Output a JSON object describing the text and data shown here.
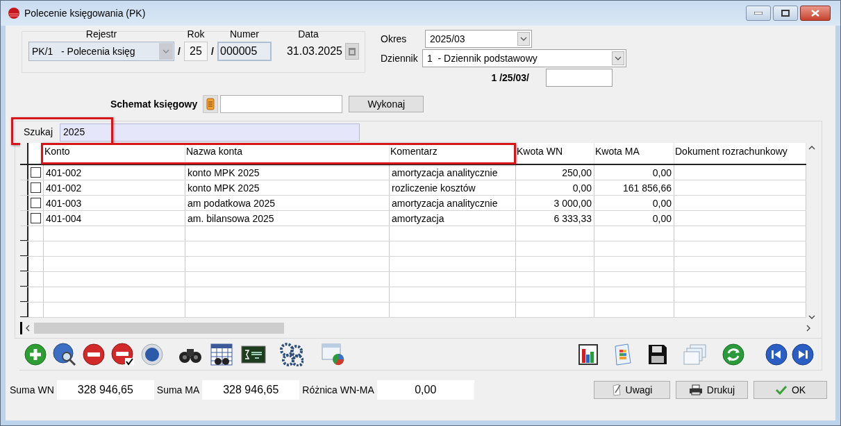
{
  "window": {
    "title": "Polecenie księgowania (PK)"
  },
  "document": {
    "rejestr": {
      "label": "Rejestr",
      "value": "PK/1   - Polecenia księg"
    },
    "rok": {
      "label": "Rok",
      "value": "25"
    },
    "numer": {
      "label": "Numer",
      "value": "000005"
    },
    "data": {
      "label": "Data",
      "value": "31.03.2025"
    },
    "separators": [
      "/",
      "/"
    ]
  },
  "okres": {
    "label": "Okres",
    "value": "2025/03"
  },
  "dziennik": {
    "label": "Dziennik",
    "value": "1  - Dziennik podstawowy",
    "number_prefix": "1 /25/03/"
  },
  "schemat": {
    "label": "Schemat księgowy",
    "button": "Wykonaj"
  },
  "search": {
    "label": "Szukaj",
    "value": "2025",
    "highlighted": true
  },
  "table": {
    "columns": [
      {
        "label": "Konto",
        "highlighted": true
      },
      {
        "label": "Nazwa konta",
        "highlighted": true
      },
      {
        "label": "Komentarz",
        "highlighted": true
      },
      {
        "label": "Kwota WN",
        "highlighted": false
      },
      {
        "label": "Kwota MA",
        "highlighted": false
      },
      {
        "label": "Dokument rozrachunkowy",
        "highlighted": false
      }
    ],
    "rows": [
      {
        "checked": false,
        "cells": [
          "401-002",
          "konto MPK 2025",
          "amortyzacja analitycznie",
          "250,00",
          "0,00"
        ]
      },
      {
        "checked": false,
        "cells": [
          "401-002",
          "konto MPK 2025",
          "rozliczenie kosztów",
          "0,00",
          "161 856,66"
        ]
      },
      {
        "checked": false,
        "cells": [
          "401-003",
          "am podatkowa 2025",
          "amortyzacja analitycznie",
          "3 000,00",
          "0,00"
        ]
      },
      {
        "checked": false,
        "cells": [
          "401-004",
          "am. bilansowa 2025",
          "amortyzacja",
          "6 333,33",
          "0,00"
        ]
      }
    ]
  },
  "totals": [
    {
      "label": "Suma WN",
      "value": "328 946,65"
    },
    {
      "label": "Suma MA",
      "value": "328 946,65"
    },
    {
      "label": "Różnica WN-MA",
      "value": "0,00"
    }
  ],
  "buttons": [
    {
      "label": "Uwagi",
      "kind": "notes"
    },
    {
      "label": "Drukuj",
      "kind": "print"
    },
    {
      "label": "OK",
      "kind": "ok"
    }
  ]
}
